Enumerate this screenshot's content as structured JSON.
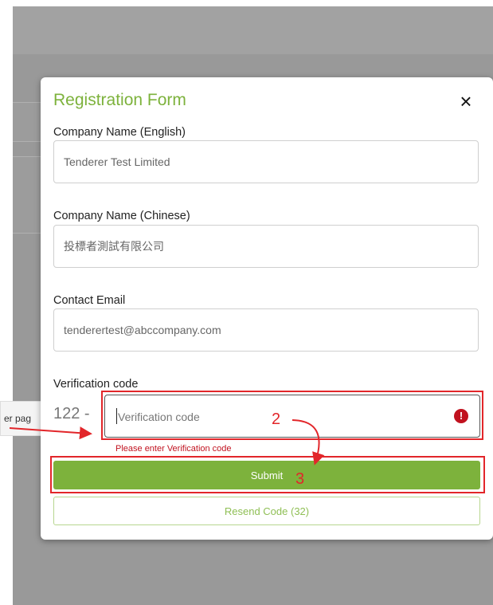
{
  "background": {
    "cut_off_text": "er pag"
  },
  "modal": {
    "title": "Registration Form",
    "close_symbol": "×",
    "fields": [
      {
        "label": "Company Name (English)",
        "value": "Tenderer Test Limited"
      },
      {
        "label": "Company Name (Chinese)",
        "value": "投標者測試有限公司"
      },
      {
        "label": "Contact Email",
        "value": "tenderertest@abccompany.com"
      }
    ],
    "verification": {
      "label": "Verification code",
      "prefix": "122 -",
      "placeholder": "Verification code",
      "value": "",
      "error_icon": "exclamation-circle-icon",
      "error_message": "Please enter Verification code"
    },
    "submit_label": "Submit",
    "resend_label": "Resend Code (32)"
  },
  "annotations": {
    "step_2": "2",
    "step_3": "3"
  },
  "colors": {
    "accent": "#7db23c",
    "error": "#c1121f",
    "annotation": "#e2262a",
    "backdrop": "#999999"
  }
}
